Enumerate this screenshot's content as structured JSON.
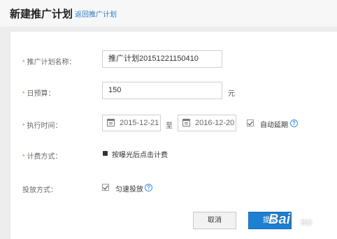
{
  "header": {
    "title": "新建推广计划",
    "back_link": "返回推广计划"
  },
  "form": {
    "plan_name": {
      "label": "推广计划名称：",
      "value": "推广计划20151221150410"
    },
    "daily_budget": {
      "label": "日预算：",
      "value": "150",
      "unit": "元"
    },
    "schedule": {
      "label": "执行时间：",
      "start_date": "2015-12-21",
      "separator": "至",
      "end_date": "2016-12-20",
      "auto_extend_label": "自动延期",
      "auto_extend_checked": true
    },
    "billing": {
      "label": "计费方式：",
      "option": "按曝光后点击计费"
    },
    "delivery": {
      "label": "投放方式：",
      "option": "匀速投放",
      "checked": true
    }
  },
  "buttons": {
    "cancel": "取消",
    "submit": "提交"
  },
  "watermark": {
    "brand": "Bai",
    "sub": "经验"
  },
  "colors": {
    "accent": "#1f7fd1",
    "link": "#2b7bc6",
    "required_star": "#e6762f"
  }
}
